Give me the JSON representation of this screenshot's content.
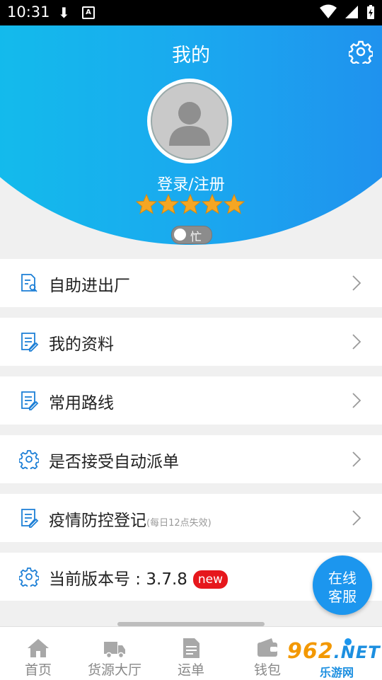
{
  "status_bar": {
    "time": "10:31"
  },
  "header": {
    "title": "我的",
    "login_label": "登录/注册",
    "rating_stars": 5,
    "status_toggle": "忙"
  },
  "menu": [
    {
      "label": "自助进出厂"
    },
    {
      "label": "我的资料"
    },
    {
      "label": "常用路线"
    },
    {
      "label": "是否接受自动派单"
    },
    {
      "label": "疫情防控登记",
      "hint": "(每日12点失效)"
    },
    {
      "label": "当前版本号 : 3.7.8",
      "badge": "new"
    }
  ],
  "customer_service": {
    "line1": "在线",
    "line2": "客服"
  },
  "tabs": [
    {
      "label": "首页",
      "icon": "home-icon"
    },
    {
      "label": "货源大厅",
      "icon": "truck-icon"
    },
    {
      "label": "运单",
      "icon": "document-icon"
    },
    {
      "label": "钱包",
      "icon": "wallet-icon"
    }
  ],
  "watermark": {
    "brand": "962",
    "domain": ".NET",
    "caption": "乐游网"
  },
  "colors": {
    "header_start": "#10c3ea",
    "header_end": "#2287ee",
    "icon_blue": "#1c7fd6",
    "badge_red": "#e6171c",
    "star": "#f5a623"
  }
}
